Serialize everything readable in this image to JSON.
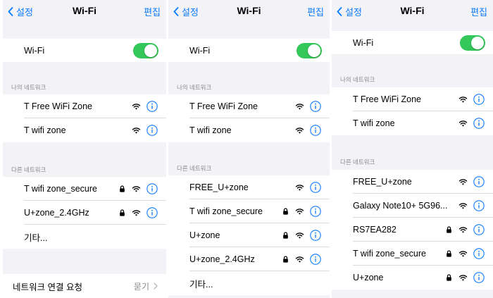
{
  "panels": [
    {
      "nav": {
        "back": "설정",
        "title": "Wi-Fi",
        "edit": "편집"
      },
      "wifi_toggle": {
        "label": "Wi-Fi",
        "on": true
      },
      "my_networks": {
        "header": "나의 네트워크",
        "items": [
          {
            "name": "T Free WiFi Zone",
            "locked": false
          },
          {
            "name": "T wifi zone",
            "locked": false
          }
        ]
      },
      "other_networks": {
        "header": "다른 네트워크",
        "items": [
          {
            "name": "T wifi zone_secure",
            "locked": true
          },
          {
            "name": "U+zone_2.4GHz",
            "locked": true
          }
        ],
        "other_label": "기타..."
      },
      "ask_to_join": {
        "label": "네트워크 연결 요청",
        "value": "묻기"
      }
    },
    {
      "nav": {
        "back": "설정",
        "title": "Wi-Fi",
        "edit": "편집"
      },
      "wifi_toggle": {
        "label": "Wi-Fi",
        "on": true
      },
      "my_networks": {
        "header": "나의 네트워크",
        "items": [
          {
            "name": "T Free WiFi Zone",
            "locked": false
          },
          {
            "name": "T wifi zone",
            "locked": false
          }
        ]
      },
      "other_networks": {
        "header": "다른 네트워크",
        "items": [
          {
            "name": "FREE_U+zone",
            "locked": false
          },
          {
            "name": "T wifi zone_secure",
            "locked": true
          },
          {
            "name": "U+zone",
            "locked": true
          },
          {
            "name": "U+zone_2.4GHz",
            "locked": true
          }
        ],
        "other_label": "기타..."
      }
    },
    {
      "nav": {
        "back": "설정",
        "title": "Wi-Fi",
        "edit": "편집"
      },
      "wifi_toggle": {
        "label": "Wi-Fi",
        "on": true
      },
      "my_networks": {
        "header": "나의 네트워크",
        "items": [
          {
            "name": "T Free WiFi Zone",
            "locked": false
          },
          {
            "name": "T wifi zone",
            "locked": false
          }
        ]
      },
      "other_networks": {
        "header": "다른 네트워크",
        "items": [
          {
            "name": "FREE_U+zone",
            "locked": false
          },
          {
            "name": "Galaxy Note10+ 5G96...",
            "locked": false
          },
          {
            "name": "RS7EA282",
            "locked": true
          },
          {
            "name": "T wifi zone_secure",
            "locked": true
          },
          {
            "name": "U+zone",
            "locked": true
          }
        ]
      }
    }
  ],
  "colors": {
    "accent": "#0a7aff",
    "toggle_on": "#34c759",
    "background": "#f2f2f7",
    "secondary_text": "#8a8a8e"
  },
  "icons": {
    "back": "chevron-left-icon",
    "wifi": "wifi-signal-icon",
    "lock": "lock-icon",
    "info": "info-circle-icon",
    "disclosure": "chevron-right-icon"
  }
}
